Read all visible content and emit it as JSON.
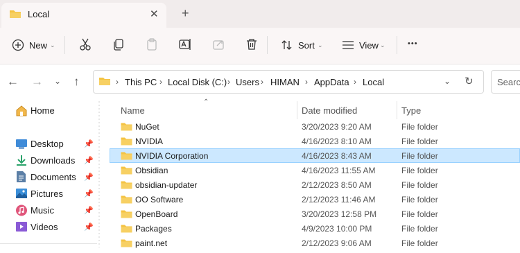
{
  "tab": {
    "title": "Local",
    "close": "✕",
    "new_tab": "+"
  },
  "toolbar": {
    "new_label": "New",
    "sort_label": "Sort",
    "view_label": "View",
    "more": "•••"
  },
  "address": {
    "crumbs": [
      "This PC",
      "Local Disk (C:)",
      "Users",
      "HIMAN",
      "AppData",
      "Local"
    ],
    "search_placeholder": "Search"
  },
  "nav": {
    "home": "Home",
    "items": [
      "Desktop",
      "Downloads",
      "Documents",
      "Pictures",
      "Music",
      "Videos"
    ]
  },
  "columns": {
    "name": "Name",
    "date": "Date modified",
    "type": "Type"
  },
  "files": [
    {
      "name": "NuGet",
      "date": "3/20/2023 9:20 AM",
      "type": "File folder"
    },
    {
      "name": "NVIDIA",
      "date": "4/16/2023 8:10 AM",
      "type": "File folder"
    },
    {
      "name": "NVIDIA Corporation",
      "date": "4/16/2023 8:43 AM",
      "type": "File folder",
      "selected": true
    },
    {
      "name": "Obsidian",
      "date": "4/16/2023 11:55 AM",
      "type": "File folder"
    },
    {
      "name": "obsidian-updater",
      "date": "2/12/2023 8:50 AM",
      "type": "File folder"
    },
    {
      "name": "OO Software",
      "date": "2/12/2023 11:46 AM",
      "type": "File folder"
    },
    {
      "name": "OpenBoard",
      "date": "3/20/2023 12:58 PM",
      "type": "File folder"
    },
    {
      "name": "Packages",
      "date": "4/9/2023 10:00 PM",
      "type": "File folder"
    },
    {
      "name": "paint.net",
      "date": "2/12/2023 9:06 AM",
      "type": "File folder"
    }
  ],
  "colors": {
    "folder": "#f4c343",
    "selection": "#cce8ff",
    "accent": "#0067c0"
  }
}
